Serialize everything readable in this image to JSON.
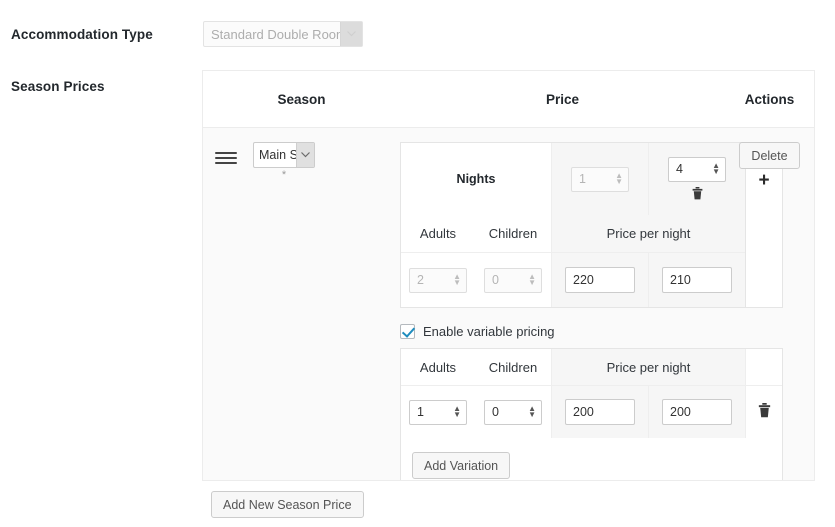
{
  "form": {
    "accommodation_type": {
      "label": "Accommodation Type",
      "selected": "Standard Double Room",
      "arrow_icon": "chevron-down-icon",
      "disabled": true
    },
    "season_prices": {
      "label": "Season Prices"
    }
  },
  "table": {
    "headers": {
      "season": "Season",
      "price": "Price",
      "actions": "Actions"
    },
    "row": {
      "drag_handle_icon": "drag-handle-icon",
      "season_select_value": "Main S",
      "season_select_arrow": "chevron-down-icon",
      "required_marker": "*",
      "delete_button": "Delete",
      "add_night_icon": "plus-icon"
    }
  },
  "price_block": {
    "nights_label": "Nights",
    "nights": [
      {
        "value": "1",
        "disabled": true,
        "has_trash": false
      },
      {
        "value": "4",
        "disabled": false,
        "has_trash": true,
        "trash_icon": "trash-icon"
      }
    ],
    "adults_label": "Adults",
    "children_label": "Children",
    "price_per_night_label": "Price per night",
    "base_row": {
      "adults": "2",
      "children": "0",
      "adults_disabled": true,
      "children_disabled": true,
      "prices": [
        "220",
        "210"
      ]
    },
    "variable_pricing": {
      "checkbox_label": "Enable variable pricing",
      "checked": true,
      "adults_label": "Adults",
      "children_label": "Children",
      "price_per_night_label": "Price per night",
      "rows": [
        {
          "adults": "1",
          "children": "0",
          "prices": [
            "200",
            "200"
          ],
          "trash_icon": "trash-icon"
        }
      ],
      "add_variation_button": "Add Variation"
    }
  },
  "footer": {
    "add_new_season_price_button": "Add New Season Price"
  },
  "colors": {
    "accent_check": "#1e8cbe",
    "row_background": "#fafafa",
    "shade_background": "#f6f6f6",
    "border": "#ececec",
    "text": "#32373c"
  },
  "spinner": {
    "up": "▲",
    "down": "▼"
  },
  "icons": {
    "trash": "🗑",
    "plus": "+",
    "chevron_down": "⌄"
  }
}
